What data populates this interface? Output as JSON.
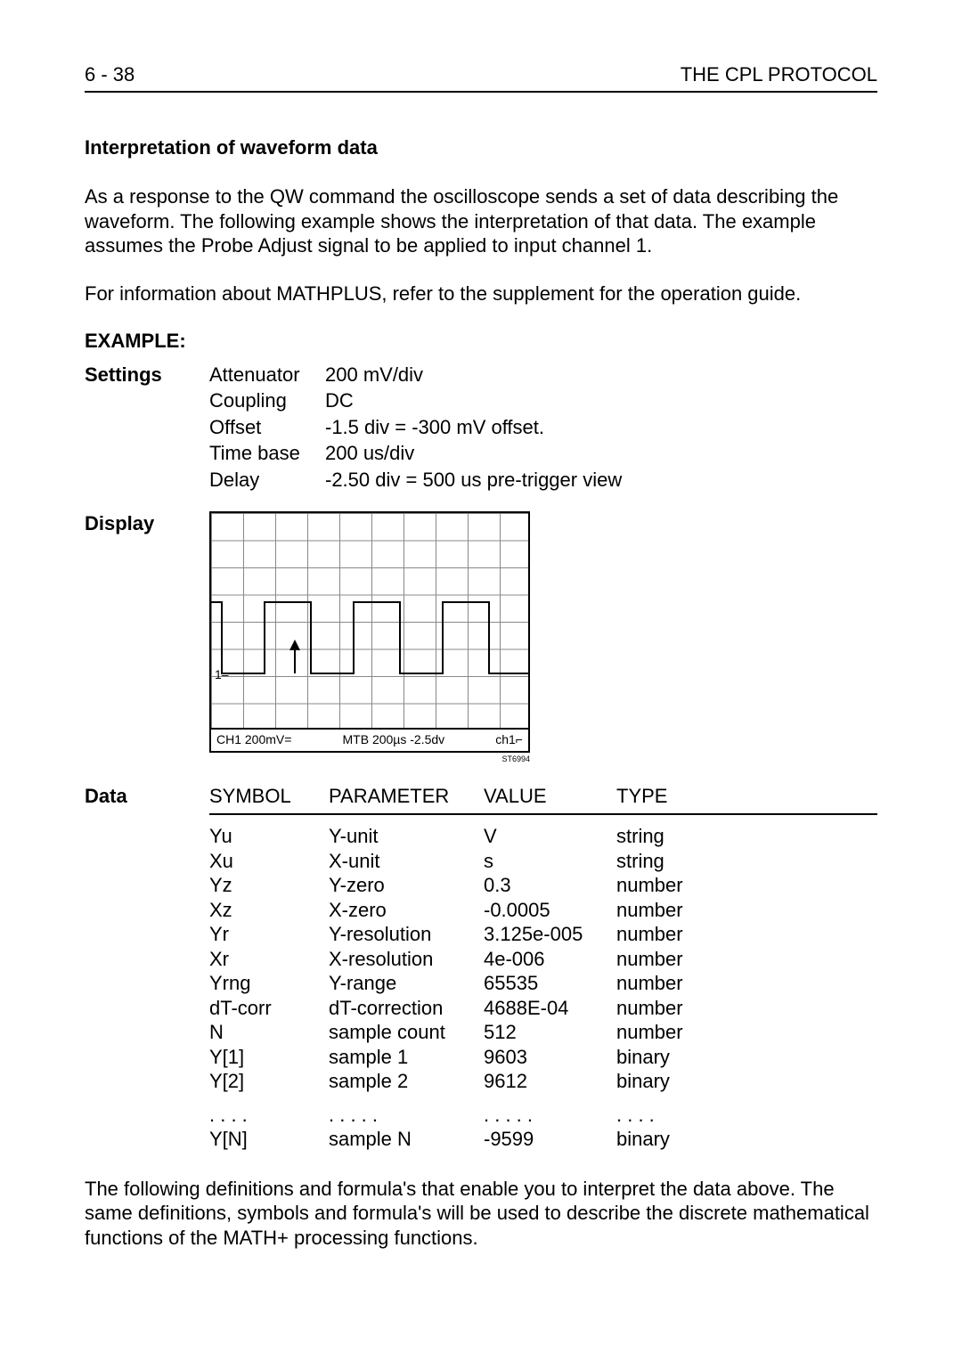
{
  "header": {
    "page_ref": "6 - 38",
    "doc_title": "THE CPL PROTOCOL"
  },
  "section_title": "Interpretation of waveform data",
  "para1": "As a response to the QW command the oscilloscope sends a set of data describing the waveform. The following example shows the interpretation of that data. The example assumes the Probe Adjust signal to be applied to input channel 1.",
  "para2": "For information about MATHPLUS, refer to the supplement for the operation guide.",
  "example_label": "EXAMPLE:",
  "settings_label": "Settings",
  "settings": [
    {
      "k": "Attenuator",
      "v": "200 mV/div"
    },
    {
      "k": "Coupling",
      "v": "DC"
    },
    {
      "k": "Offset",
      "v": "-1.5 div = -300 mV offset."
    },
    {
      "k": "Time base",
      "v": "200 us/div"
    },
    {
      "k": "Delay",
      "v": "-2.50 div = 500 us pre-trigger view"
    }
  ],
  "display_label": "Display",
  "scope": {
    "one_marker": "1",
    "readout_left": "CH1    200mV=",
    "readout_mid": "MTB 200µs  -2.5dv",
    "readout_right": "ch1⌐",
    "fig_id": "ST6994"
  },
  "data_label": "Data",
  "data_head": {
    "c1": "SYMBOL",
    "c2": "PARAMETER",
    "c3": "VALUE",
    "c4": "TYPE"
  },
  "data_rows": [
    {
      "c1": "Yu",
      "c2": "Y-unit",
      "c3": "V",
      "c4": "string"
    },
    {
      "c1": "Xu",
      "c2": "X-unit",
      "c3": "s",
      "c4": "string"
    },
    {
      "c1": "Yz",
      "c2": "Y-zero",
      "c3": "0.3",
      "c4": "number"
    },
    {
      "c1": "Xz",
      "c2": "X-zero",
      "c3": "-0.0005",
      "c4": "number"
    },
    {
      "c1": "Yr",
      "c2": "Y-resolution",
      "c3": "3.125e-005",
      "c4": "number"
    },
    {
      "c1": "Xr",
      "c2": "X-resolution",
      "c3": "4e-006",
      "c4": "number"
    },
    {
      "c1": "Yrng",
      "c2": "Y-range",
      "c3": "65535",
      "c4": "number"
    },
    {
      "c1": "dT-corr",
      "c2": "dT-correction",
      "c3": "4688E-04",
      "c4": "number"
    },
    {
      "c1": "N",
      "c2": "sample count",
      "c3": "512",
      "c4": "number"
    },
    {
      "c1": "Y[1]",
      "c2": "sample 1",
      "c3": "9603",
      "c4": "binary"
    },
    {
      "c1": "Y[2]",
      "c2": "sample 2",
      "c3": "9612",
      "c4": "binary"
    },
    {
      "c1": ". . . .",
      "c2": ". . . . .",
      "c3": ". . . . .",
      "c4": ". . . ."
    },
    {
      "c1": "Y[N]",
      "c2": "sample N",
      "c3": "-9599",
      "c4": "binary"
    }
  ],
  "para3": "The following definitions and formula's that enable you to interpret the data above. The same definitions, symbols and formula's will be used to describe the discrete mathematical functions of the MATH+ processing functions."
}
